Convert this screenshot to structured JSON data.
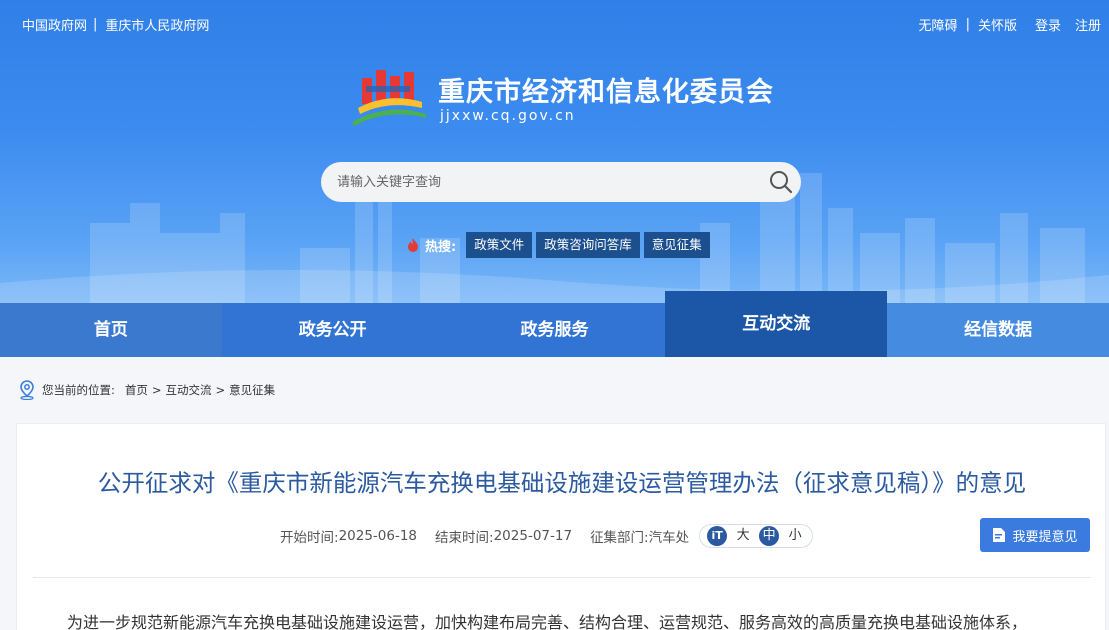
{
  "topbar": {
    "left_links": [
      "中国政府网",
      "重庆市人民政府网"
    ],
    "right_links": [
      "无障碍",
      "关怀版",
      "登录",
      "注册"
    ]
  },
  "site": {
    "title": "重庆市经济和信息化委员会",
    "url": "jjxxw.cq.gov.cn"
  },
  "search": {
    "placeholder": "请输入关键字查询"
  },
  "hot": {
    "label": "热搜:",
    "tags": [
      "政策文件",
      "政策咨询问答库",
      "意见征集"
    ]
  },
  "nav": {
    "items": [
      "首页",
      "政务公开",
      "政务服务",
      "互动交流",
      "经信数据"
    ],
    "active_index": 3
  },
  "breadcrumb": {
    "prefix": "您当前的位置:",
    "path": [
      "首页",
      ">",
      "互动交流",
      ">",
      "意见征集"
    ]
  },
  "article": {
    "title": "公开征求对《重庆市新能源汽车充换电基础设施建设运营管理办法（征求意见稿）》的意见",
    "start_label": "开始时间:",
    "start_value": "2025-06-18",
    "end_label": "结束时间:",
    "end_value": "2025-07-17",
    "dept_label": "征集部门:",
    "dept_value": "汽车处",
    "font_icon": "iT",
    "font_sizes": [
      "大",
      "中",
      "小"
    ],
    "font_selected": "中",
    "feedback_button": "我要提意见",
    "body_first_line": "为进一步规范新能源汽车充换电基础设施建设运营，加快构建布局完善、结构合理、运营规范、服务高效的高质量充换电基础设施体系，"
  },
  "colors": {
    "banner_top": "#2f7fe8",
    "nav_active": "#1b56a7",
    "title_blue": "#2b5aa0",
    "button_blue": "#3b7be0"
  }
}
